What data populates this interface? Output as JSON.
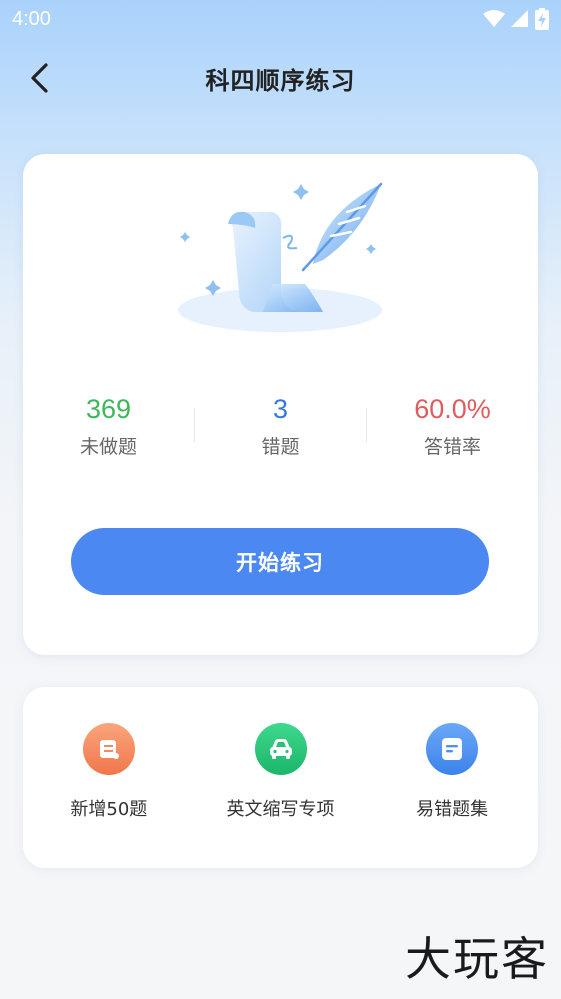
{
  "status_bar": {
    "time": "4:00"
  },
  "nav": {
    "title": "科四顺序练习",
    "back_icon": "chevron-left-icon"
  },
  "stats": [
    {
      "value": "369",
      "label": "未做题",
      "color": "#3cb85a"
    },
    {
      "value": "3",
      "label": "错题",
      "color": "#3579e0"
    },
    {
      "value": "60.0%",
      "label": "答错率",
      "color": "#e05c5c"
    }
  ],
  "start_button": {
    "label": "开始练习",
    "color": "#4b88f2"
  },
  "actions": [
    {
      "label": "新增50题",
      "icon": "scroll-icon",
      "color": "#f48a5c"
    },
    {
      "label": "英文缩写专项",
      "icon": "car-icon",
      "color": "#27c278"
    },
    {
      "label": "易错题集",
      "icon": "document-icon",
      "color": "#4c91f0"
    }
  ],
  "watermark": "大玩客"
}
